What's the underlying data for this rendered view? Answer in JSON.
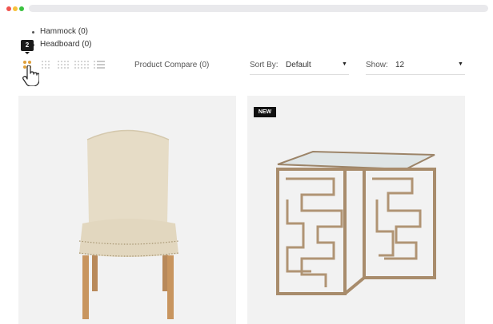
{
  "categories": [
    "Hammock (0)",
    "Headboard (0)"
  ],
  "tooltip": "2",
  "toolbar": {
    "compare": "Product Compare (0)",
    "sort": {
      "label": "Sort By:",
      "value": "Default"
    },
    "show": {
      "label": "Show:",
      "value": "12"
    }
  },
  "products": [
    {
      "badge": ""
    },
    {
      "badge": "NEW"
    }
  ],
  "colors": {
    "accent": "#e0a03a",
    "badge": "#111111",
    "card": "#f2f2f2"
  },
  "icons": [
    "grid-2-icon",
    "grid-3-icon",
    "grid-4-icon",
    "grid-5-icon",
    "list-view-icon",
    "pointer-hand-icon",
    "caret-down-icon"
  ]
}
